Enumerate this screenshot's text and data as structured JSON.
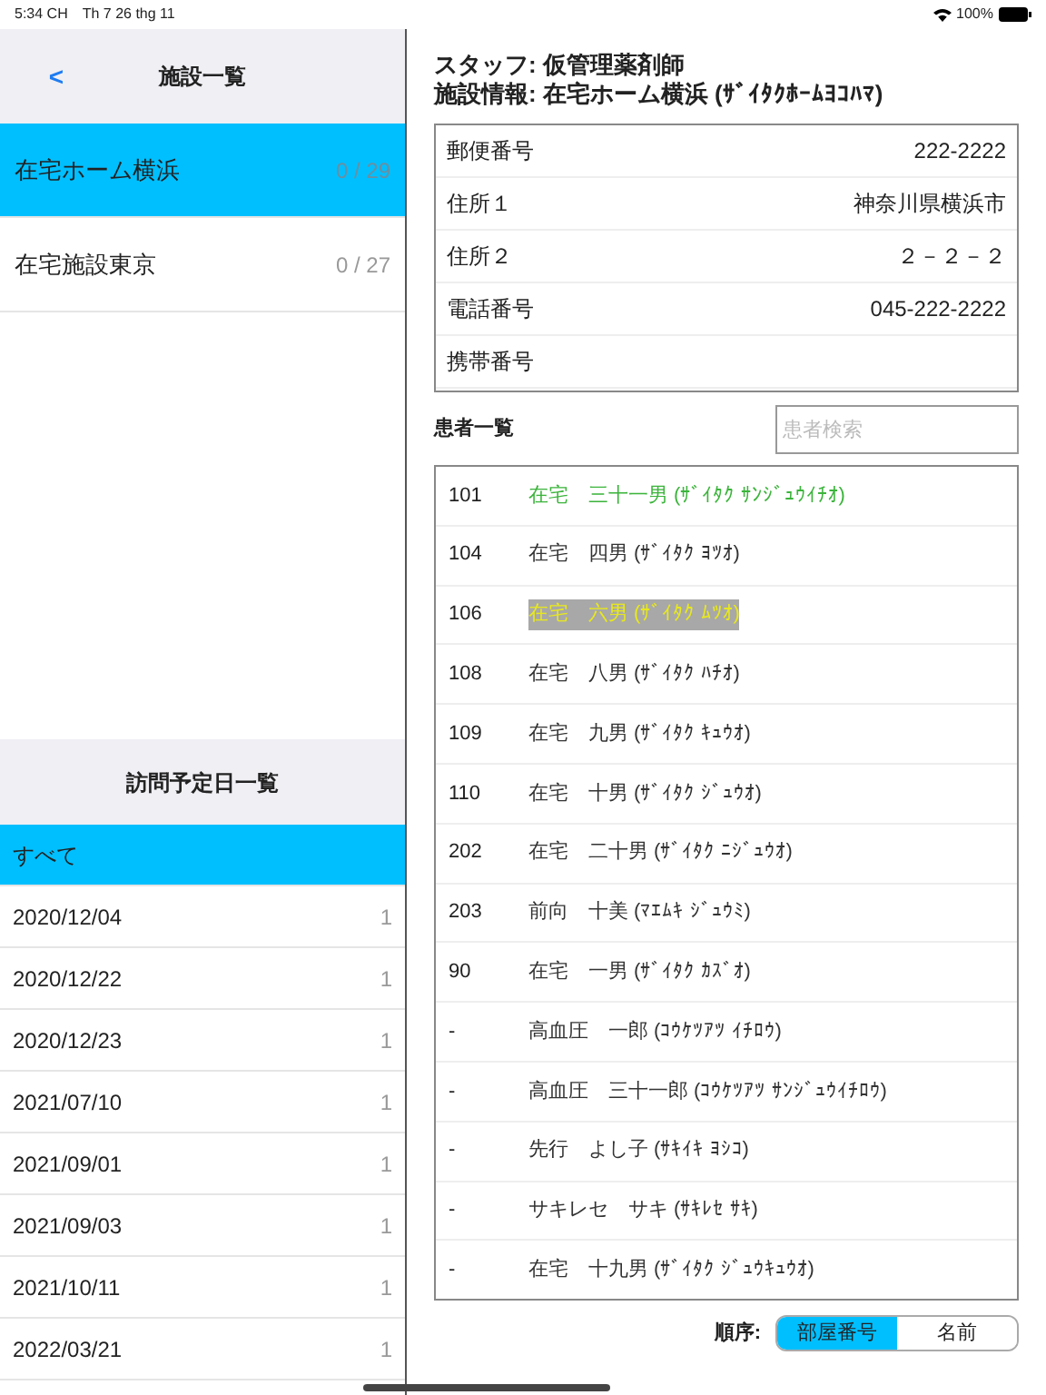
{
  "status_bar": {
    "time": "5:34 CH",
    "date": "Th 7 26 thg 11",
    "battery": "100%"
  },
  "facility_pane": {
    "back": "<",
    "title": "施設一覧",
    "items": [
      {
        "name": "在宅ホーム横浜",
        "count": "0 / 29",
        "selected": true
      },
      {
        "name": "在宅施設東京",
        "count": "0 / 27",
        "selected": false
      }
    ]
  },
  "visit_pane": {
    "title": "訪問予定日一覧",
    "items": [
      {
        "date": "すべて",
        "selected": true
      },
      {
        "date": "2020/12/04",
        "count": "1",
        "selected": false
      },
      {
        "date": "2020/12/22",
        "count": "1",
        "selected": false
      },
      {
        "date": "2020/12/23",
        "count": "1",
        "selected": false
      },
      {
        "date": "2021/07/10",
        "count": "1",
        "selected": false
      },
      {
        "date": "2021/09/01",
        "count": "1",
        "selected": false
      },
      {
        "date": "2021/09/03",
        "count": "1",
        "selected": false
      },
      {
        "date": "2021/10/11",
        "count": "1",
        "selected": false
      },
      {
        "date": "2022/03/21",
        "count": "1",
        "selected": false
      }
    ]
  },
  "header": {
    "staff": "スタッフ: 仮管理薬剤師",
    "facility": "施設情報: 在宅ホーム横浜 (ｻﾞｲﾀｸﾎｰﾑﾖｺﾊﾏ)"
  },
  "info": [
    {
      "label": "郵便番号",
      "value": "222-2222"
    },
    {
      "label": "住所１",
      "value": "神奈川県横浜市"
    },
    {
      "label": "住所２",
      "value": "２－２－２"
    },
    {
      "label": "電話番号",
      "value": "045-222-2222"
    },
    {
      "label": "携帯番号"
    }
  ],
  "patients": {
    "title": "患者一覧",
    "search": {
      "placeholder": "患者検索"
    },
    "rows": [
      {
        "room": "101",
        "name": "在宅　三十一男 (ｻﾞｲﾀｸ ｻﾝｼﾞｭｳｲﾁｵ)",
        "kind": "emphasized"
      },
      {
        "room": "104",
        "name": "在宅　四男 (ｻﾞｲﾀｸ ﾖﾂｵ)",
        "kind": "plain"
      },
      {
        "room": "106",
        "name": "在宅　六男 (ｻﾞｲﾀｸ ﾑﾂｵ)",
        "kind": "highlighted"
      },
      {
        "room": "108",
        "name": "在宅　八男 (ｻﾞｲﾀｸ ﾊﾁｵ)",
        "kind": "plain"
      },
      {
        "room": "109",
        "name": "在宅　九男 (ｻﾞｲﾀｸ ｷｭｳｵ)",
        "kind": "plain"
      },
      {
        "room": "110",
        "name": "在宅　十男 (ｻﾞｲﾀｸ ｼﾞｭｳｵ)",
        "kind": "plain"
      },
      {
        "room": "202",
        "name": "在宅　二十男 (ｻﾞｲﾀｸ ﾆｼﾞｭｳｵ)",
        "kind": "plain"
      },
      {
        "room": "203",
        "name": "前向　十美 (ﾏｴﾑｷ ｼﾞｭｳﾐ)",
        "kind": "plain"
      },
      {
        "room": "90",
        "name": "在宅　一男 (ｻﾞｲﾀｸ ｶｽﾞｵ)",
        "kind": "plain"
      },
      {
        "room": "-",
        "name": "高血圧　一郎 (ｺｳｹﾂｱﾂ ｲﾁﾛｳ)",
        "kind": "plain"
      },
      {
        "room": "-",
        "name": "高血圧　三十一郎 (ｺｳｹﾂｱﾂ ｻﾝｼﾞｭｳｲﾁﾛｳ)",
        "kind": "plain"
      },
      {
        "room": "-",
        "name": "先行　よし子 (ｻｷｲｷ ﾖｼｺ)",
        "kind": "plain"
      },
      {
        "room": "-",
        "name": "サキレセ　サキ (ｻｷﾚｾ ｻｷ)",
        "kind": "plain"
      },
      {
        "room": "-",
        "name": "在宅　十九男 (ｻﾞｲﾀｸ ｼﾞｭｳｷｭｳｵ)",
        "kind": "plain"
      }
    ]
  },
  "sort": {
    "label": "順序:",
    "options": [
      {
        "label": "部屋番号",
        "selected": true
      },
      {
        "label": "名前",
        "selected": false
      }
    ]
  }
}
